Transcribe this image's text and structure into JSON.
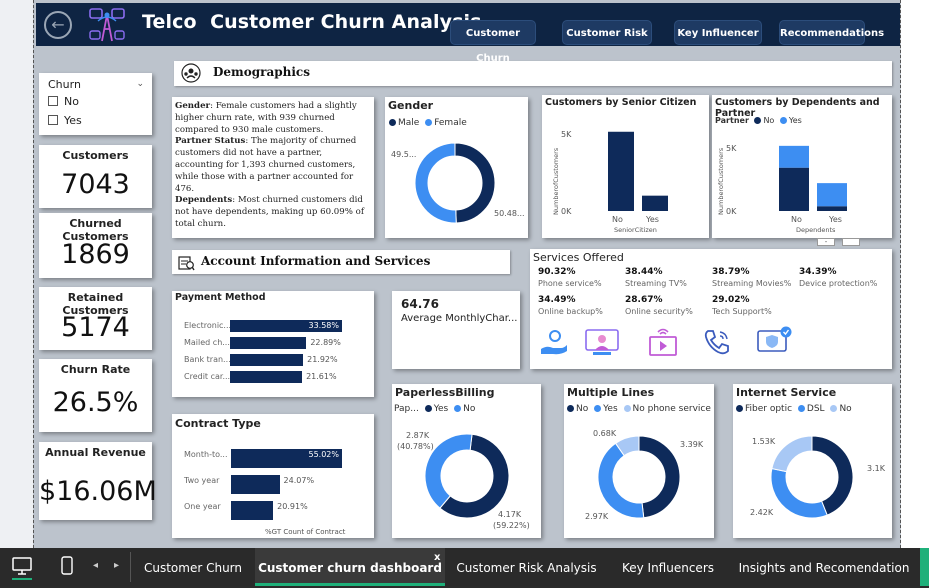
{
  "header": {
    "title": "Telco  Customer Churn Analysis",
    "nav": [
      "Customer Churn",
      "Customer Risk",
      "Key Influencer",
      "Recommendations"
    ]
  },
  "filter": {
    "title": "Churn",
    "options": [
      "No",
      "Yes"
    ]
  },
  "kpis": [
    {
      "label": "Customers",
      "value": "7043"
    },
    {
      "label": "Churned Customers",
      "value": "1869"
    },
    {
      "label": "Retained Customers",
      "value": "5174"
    },
    {
      "label": "Churn Rate",
      "value": "26.5%"
    },
    {
      "label": "Annual Revenue",
      "value": "$16.06M"
    }
  ],
  "sections": {
    "demographics": "Demographics",
    "account": "Account Information and Services"
  },
  "narrative": {
    "gender_h": "Gender",
    "gender_t": ": Female customers had a slightly higher churn rate, with 939 churned compared to 930 male customers.",
    "partner_h": "Partner Status",
    "partner_t": ": The majority of churned customers did not have a partner, accounting for 1,393 churned customers, while those with a partner accounted for 476.",
    "dep_h": "Dependents",
    "dep_t": ": Most churned customers did not have dependents, making up 60.09% of total churn."
  },
  "gender": {
    "title": "Gender",
    "legend": [
      "Male",
      "Female"
    ],
    "labels": [
      "49.5...",
      "50.48..."
    ],
    "colors": [
      "#0e2a5a",
      "#3d8ef2"
    ]
  },
  "senior": {
    "title": "Customers by Senior Citizen",
    "ylabel": "NumberofCustomers",
    "xlabel": "SeniorCitizen",
    "ticks": [
      "5K",
      "0K"
    ],
    "categories": [
      "No",
      "Yes"
    ]
  },
  "dependents": {
    "title": "Customers by Dependents and Partner",
    "legend_title": "Partner",
    "legend": [
      "No",
      "Yes"
    ],
    "ylabel": "NumberofCustomers",
    "xlabel": "Dependents",
    "ticks": [
      "5K",
      "0K"
    ],
    "categories": [
      "No",
      "Yes"
    ]
  },
  "services": {
    "title": "Services Offered",
    "items": [
      {
        "pct": "90.32%",
        "name": "Phone service%"
      },
      {
        "pct": "38.44%",
        "name": "Streaming TV%"
      },
      {
        "pct": "38.79%",
        "name": "Streaming Movies%"
      },
      {
        "pct": "34.39%",
        "name": "Device protection%"
      },
      {
        "pct": "34.49%",
        "name": "Online backup%"
      },
      {
        "pct": "28.67%",
        "name": "Online security%"
      },
      {
        "pct": "29.02%",
        "name": "Tech Support%"
      }
    ]
  },
  "avgcharge": {
    "value": "64.76",
    "label": "Average MonthlyChar..."
  },
  "payment": {
    "title": "Payment Method",
    "labels": [
      "Electronic...",
      "Mailed ch...",
      "Bank tran...",
      "Credit car..."
    ],
    "values_text": [
      "33.58%",
      "22.89%",
      "21.92%",
      "21.61%"
    ]
  },
  "contract": {
    "title": "Contract Type",
    "labels": [
      "Month-to...",
      "Two year",
      "One year"
    ],
    "values_text": [
      "55.02%",
      "24.07%",
      "20.91%"
    ],
    "caption": "%GT Count of Contract"
  },
  "paperless": {
    "title": "PaperlessBilling",
    "legend_title": "Pap...",
    "legend": [
      "Yes",
      "No"
    ],
    "labels": [
      "2.87K",
      "(40.78%)",
      "4.17K",
      "(59.22%)"
    ]
  },
  "multilines": {
    "title": "Multiple Lines",
    "legend": [
      "No",
      "Yes",
      "No phone service"
    ],
    "labels": [
      "0.68K",
      "3.39K",
      "2.97K"
    ]
  },
  "internet": {
    "title": "Internet Service",
    "legend": [
      "Fiber optic",
      "DSL",
      "No"
    ],
    "labels": [
      "1.53K",
      "3.1K",
      "2.42K"
    ]
  },
  "tabs": [
    "Customer Churn",
    "Customer churn dashboard",
    "Customer Risk Analysis",
    "Key Influencers",
    "Insights and Recomendation"
  ],
  "tab_close": "x",
  "chart_data": [
    {
      "type": "pie",
      "title": "Gender",
      "categories": [
        "Male",
        "Female"
      ],
      "values": [
        49.5,
        50.48
      ]
    },
    {
      "type": "bar",
      "title": "Customers by Senior Citizen",
      "categories": [
        "No",
        "Yes"
      ],
      "values": [
        5901,
        1142
      ],
      "ylabel": "NumberofCustomers",
      "xlabel": "SeniorCitizen"
    },
    {
      "type": "bar",
      "title": "Customers by Dependents and Partner",
      "categories": [
        "No",
        "Yes"
      ],
      "series": [
        {
          "name": "No",
          "values": [
            3280,
            361
          ]
        },
        {
          "name": "Yes",
          "values": [
            1653,
            1749
          ]
        }
      ],
      "ylabel": "NumberofCustomers",
      "xlabel": "Dependents"
    },
    {
      "type": "bar",
      "title": "Payment Method",
      "categories": [
        "Electronic...",
        "Mailed ch...",
        "Bank tran...",
        "Credit car..."
      ],
      "values": [
        33.58,
        22.89,
        21.92,
        21.61
      ]
    },
    {
      "type": "bar",
      "title": "Contract Type",
      "categories": [
        "Month-to...",
        "Two year",
        "One year"
      ],
      "values": [
        55.02,
        24.07,
        20.91
      ],
      "xlabel": "%GT Count of Contract"
    },
    {
      "type": "pie",
      "title": "PaperlessBilling",
      "categories": [
        "Yes",
        "No"
      ],
      "values": [
        4.17,
        2.87
      ]
    },
    {
      "type": "pie",
      "title": "Multiple Lines",
      "categories": [
        "No",
        "Yes",
        "No phone service"
      ],
      "values": [
        3.39,
        2.97,
        0.68
      ]
    },
    {
      "type": "pie",
      "title": "Internet Service",
      "categories": [
        "Fiber optic",
        "DSL",
        "No"
      ],
      "values": [
        3.1,
        2.42,
        1.53
      ]
    }
  ]
}
